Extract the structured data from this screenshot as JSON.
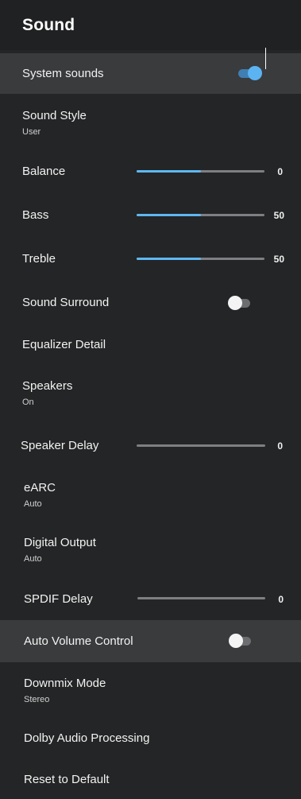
{
  "header": {
    "title": "Sound"
  },
  "items": {
    "system_sounds": {
      "label": "System sounds",
      "state": "on"
    },
    "sound_style": {
      "label": "Sound Style",
      "value": "User"
    },
    "balance": {
      "label": "Balance",
      "value": "0",
      "level": 0.5
    },
    "bass": {
      "label": "Bass",
      "value": "50",
      "level": 0.5
    },
    "treble": {
      "label": "Treble",
      "value": "50",
      "level": 0.5
    },
    "sound_surround": {
      "label": "Sound Surround",
      "state": "off"
    },
    "equalizer_detail": {
      "label": "Equalizer Detail"
    },
    "speakers": {
      "label": "Speakers",
      "value": "On"
    },
    "speaker_delay": {
      "label": "Speaker Delay",
      "value": "0",
      "level": 0
    },
    "earc": {
      "label": "eARC",
      "value": "Auto"
    },
    "digital_output": {
      "label": "Digital Output",
      "value": "Auto"
    },
    "spdif_delay": {
      "label": "SPDIF Delay",
      "value": "0",
      "level": 0
    },
    "auto_volume_control": {
      "label": "Auto Volume Control",
      "state": "off"
    },
    "downmix_mode": {
      "label": "Downmix Mode",
      "value": "Stereo"
    },
    "dolby_audio_processing": {
      "label": "Dolby Audio Processing"
    },
    "reset_to_default": {
      "label": "Reset to Default"
    }
  },
  "colors": {
    "background": "#242526",
    "highlight": "#3a3b3d",
    "accent": "#5eb8f0",
    "track": "#7d7f82"
  }
}
